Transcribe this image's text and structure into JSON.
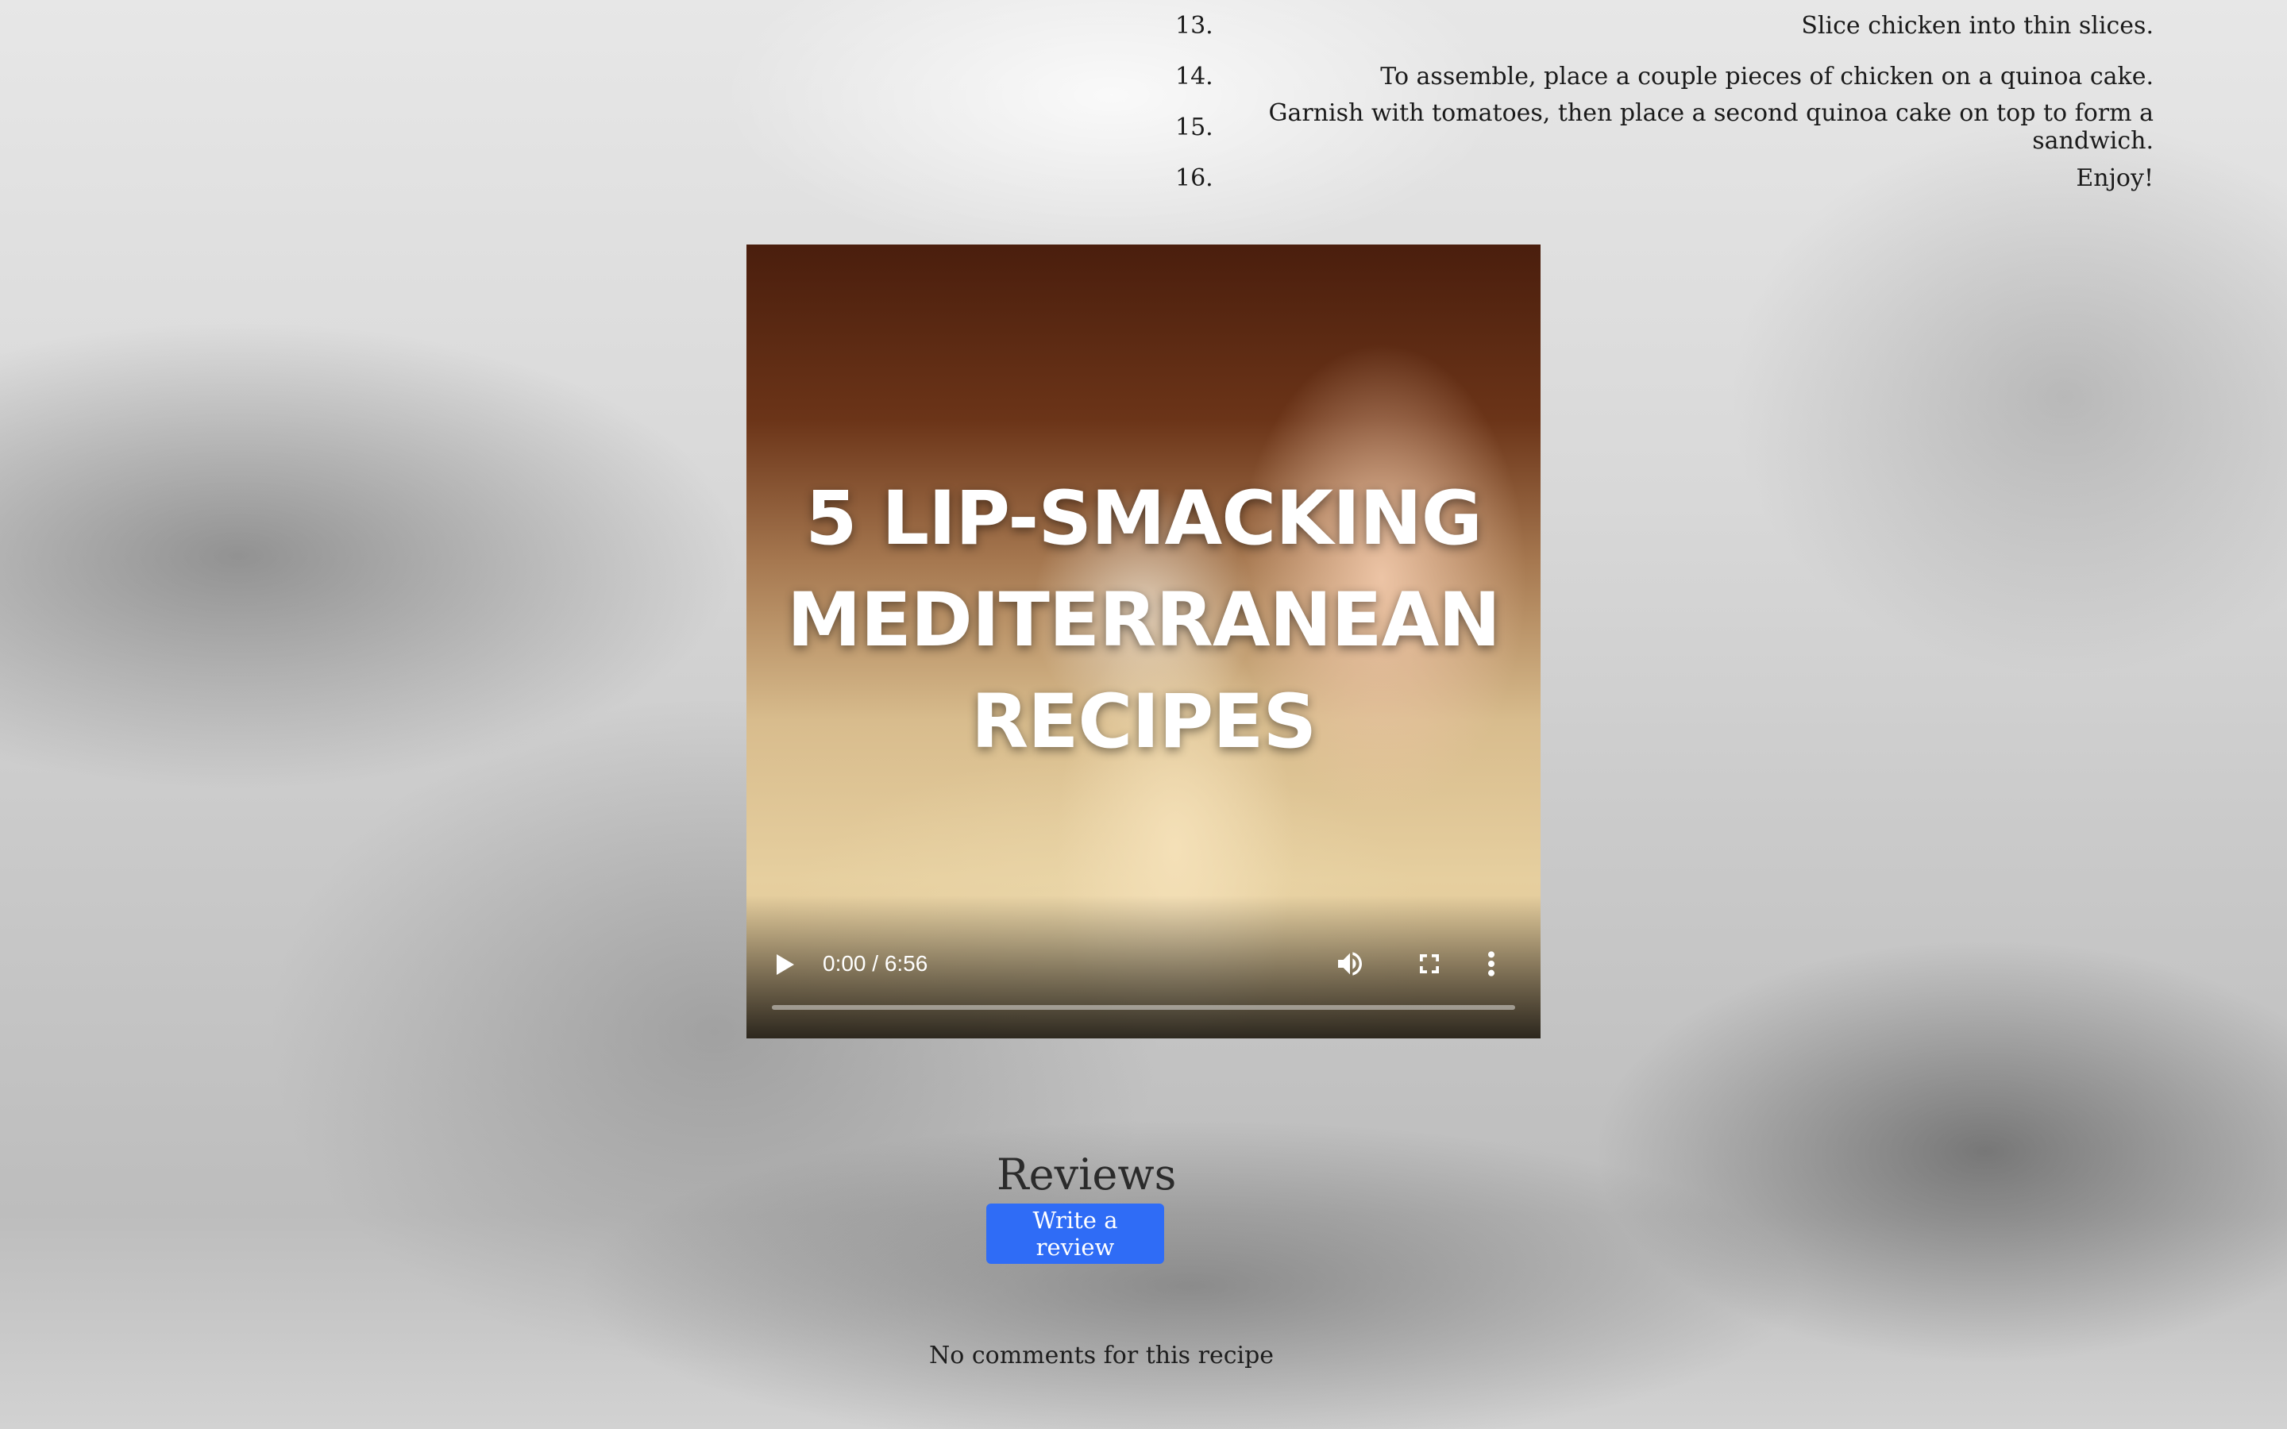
{
  "instructions": {
    "steps": [
      {
        "number": "13.",
        "text": "Slice chicken into thin slices."
      },
      {
        "number": "14.",
        "text": "To assemble, place a couple pieces of chicken on a quinoa cake."
      },
      {
        "number": "15.",
        "text": "Garnish with tomatoes, then place a second quinoa cake on top to form a sandwich."
      },
      {
        "number": "16.",
        "text": "Enjoy!"
      }
    ]
  },
  "video": {
    "title_lines": [
      "5 LIP-SMACKING",
      "MEDITERRANEAN",
      "RECIPES"
    ],
    "time": "0:00 / 6:56",
    "progress": 0,
    "icons": {
      "play": "play-icon",
      "volume": "volume-icon",
      "fullscreen": "fullscreen-icon",
      "more": "more-vertical-icon"
    }
  },
  "reviews": {
    "title": "Reviews",
    "write_button": "Write a review",
    "empty_text": "No comments for this recipe"
  },
  "colors": {
    "button_bg": "#2f6cf6",
    "button_text": "#ffffff"
  }
}
